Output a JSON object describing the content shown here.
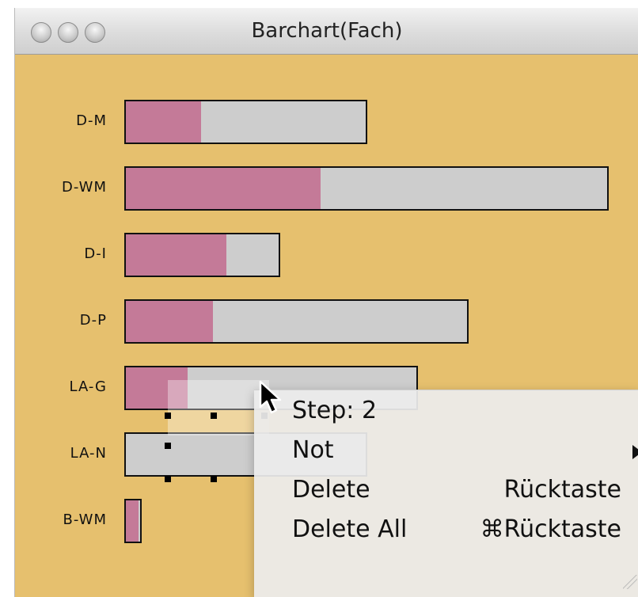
{
  "window": {
    "title": "Barchart(Fach)"
  },
  "rows": [
    {
      "label": "D-M",
      "total": 307,
      "highlighted": 95
    },
    {
      "label": "D-WM",
      "total": 612,
      "highlighted": 246
    },
    {
      "label": "D-I",
      "total": 197,
      "highlighted": 127
    },
    {
      "label": "D-P",
      "total": 435,
      "highlighted": 110
    },
    {
      "label": "LA-G",
      "total": 371,
      "highlighted": 78
    },
    {
      "label": "LA-N",
      "total": 307,
      "highlighted": 0
    },
    {
      "label": "B-WM",
      "total": 22,
      "highlighted": 16
    }
  ],
  "colors": {
    "background": "#E6C06E",
    "bar": "#CDCDCD",
    "highlight": "#C47A98",
    "outline": "#111111"
  },
  "context_menu": {
    "items": [
      {
        "label": "Step: 2",
        "shortcut": "",
        "submenu": false
      },
      {
        "label": "Not",
        "shortcut": "",
        "submenu": true
      },
      {
        "label": "Delete",
        "shortcut": "Rücktaste",
        "submenu": false
      },
      {
        "label": "Delete All",
        "shortcut": "⌘Rücktaste",
        "submenu": false
      }
    ]
  },
  "icons": {
    "window_buttons": [
      "close-icon",
      "minimize-icon",
      "zoom-icon"
    ],
    "pointer": "arrow-cursor-icon"
  }
}
